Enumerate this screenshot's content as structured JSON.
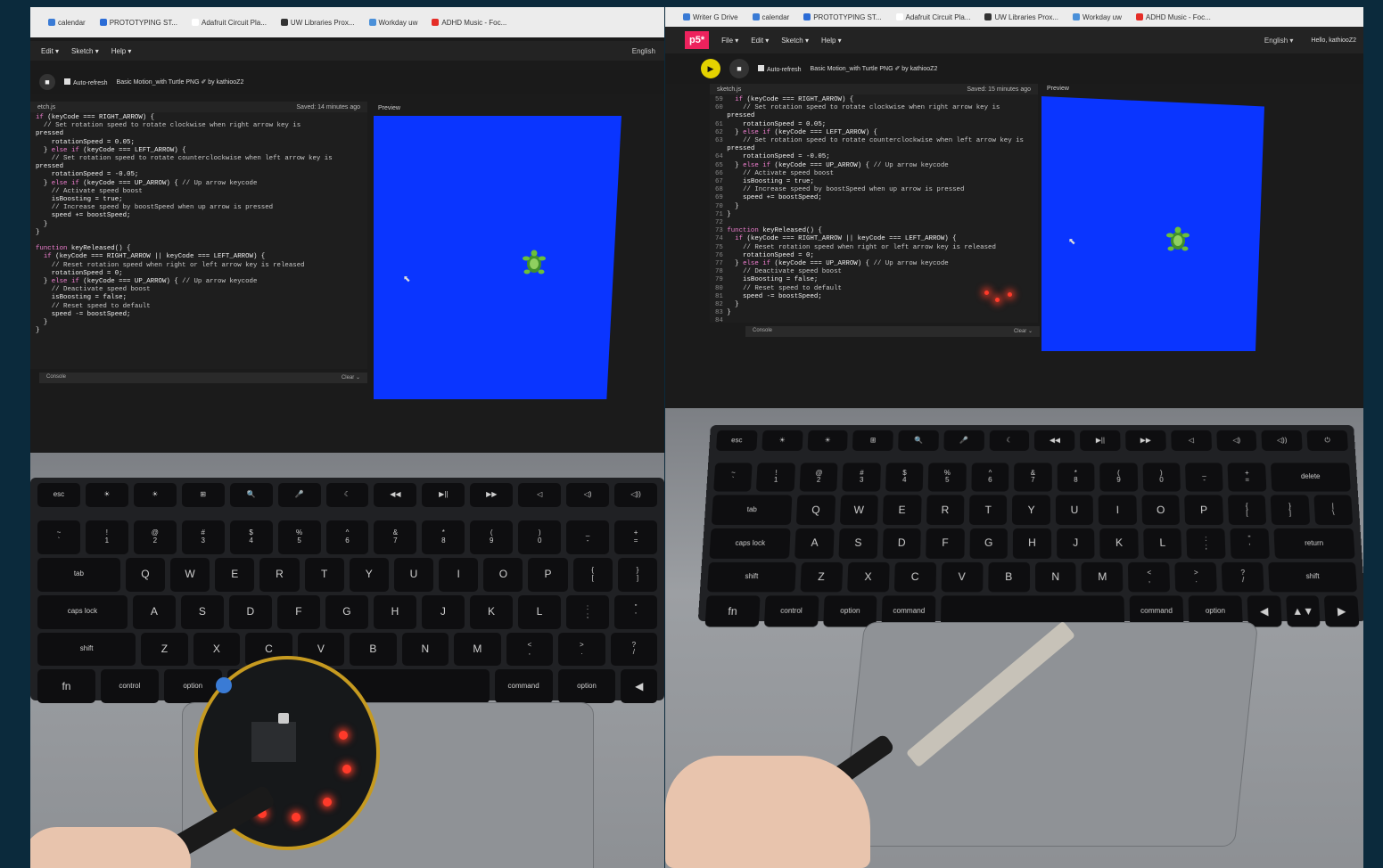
{
  "left_photo": {
    "bookmarks": [
      {
        "label": "calendar",
        "color": "#3a7bd5"
      },
      {
        "label": "PROTOTYPING ST...",
        "color": "#2b6cd6"
      },
      {
        "label": "Adafruit Circuit Pla...",
        "color": "#ffffff"
      },
      {
        "label": "UW Libraries Prox...",
        "color": "#333333"
      },
      {
        "label": "Workday uw",
        "color": "#4a90d9"
      },
      {
        "label": "ADHD Music - Foc...",
        "color": "#e52d27"
      }
    ],
    "menu": [
      "Edit ▾",
      "Sketch ▾",
      "Help ▾"
    ],
    "language": "English",
    "auto_refresh": "Auto-refresh",
    "sketch_name": "Basic Motion_with Turtle PNG ✐ by kathiooZ2",
    "file_tab": "etch.js",
    "saved": "Saved: 14 minutes ago",
    "preview": "Preview",
    "console": "Console",
    "clear": "Clear ⌄",
    "code": "if (keyCode === RIGHT_ARROW) {\n  // Set rotation speed to rotate clockwise when right arrow key is\npressed\n    rotationSpeed = 0.05;\n  } else if (keyCode === LEFT_ARROW) {\n    // Set rotation speed to rotate counterclockwise when left arrow key is\npressed\n    rotationSpeed = -0.05;\n  } else if (keyCode === UP_ARROW) { // Up arrow keycode\n    // Activate speed boost\n    isBoosting = true;\n    // Increase speed by boostSpeed when up arrow is pressed\n    speed += boostSpeed;\n  }\n}\n\nfunction keyReleased() {\n  if (keyCode === RIGHT_ARROW || keyCode === LEFT_ARROW) {\n    // Reset rotation speed when right or left arrow key is released\n    rotationSpeed = 0;\n  } else if (keyCode === UP_ARROW) { // Up arrow keycode\n    // Deactivate speed boost\n    isBoosting = false;\n    // Reset speed to default\n    speed -= boostSpeed;\n  }\n}"
  },
  "right_photo": {
    "bookmarks": [
      {
        "label": "Writer G Drive",
        "color": "#3a7bd5"
      },
      {
        "label": "calendar",
        "color": "#3a7bd5"
      },
      {
        "label": "PROTOTYPING ST...",
        "color": "#2b6cd6"
      },
      {
        "label": "Adafruit Circuit Pla...",
        "color": "#ffffff"
      },
      {
        "label": "UW Libraries Prox...",
        "color": "#333333"
      },
      {
        "label": "Workday uw",
        "color": "#4a90d9"
      },
      {
        "label": "ADHD Music - Foc...",
        "color": "#e52d27"
      }
    ],
    "logo": "p5*",
    "menu": [
      "File ▾",
      "Edit ▾",
      "Sketch ▾",
      "Help ▾"
    ],
    "language": "English ▾",
    "user": "Hello, kathiooZ2",
    "auto_refresh": "Auto-refresh",
    "sketch_name": "Basic Motion_with Turtle PNG ✐ by kathiooZ2",
    "file_tab": "sketch.js",
    "saved": "Saved: 15 minutes ago",
    "preview": "Preview",
    "console": "Console",
    "clear": "Clear ⌄",
    "code": "59   if (keyCode === RIGHT_ARROW) {\n60     // Set rotation speed to rotate clockwise when right arrow key is\n   pressed\n61     rotationSpeed = 0.05;\n62   } else if (keyCode === LEFT_ARROW) {\n63     // Set rotation speed to rotate counterclockwise when left arrow key is\n   pressed\n64     rotationSpeed = -0.05;\n65   } else if (keyCode === UP_ARROW) { // Up arrow keycode\n66     // Activate speed boost\n67     isBoosting = true;\n68     // Increase speed by boostSpeed when up arrow is pressed\n69     speed += boostSpeed;\n70   }\n71 }\n72\n73 function keyReleased() {\n74   if (keyCode === RIGHT_ARROW || keyCode === LEFT_ARROW) {\n75     // Reset rotation speed when right or left arrow key is released\n76     rotationSpeed = 0;\n77   } else if (keyCode === UP_ARROW) { // Up arrow keycode\n78     // Deactivate speed boost\n79     isBoosting = false;\n80     // Reset speed to default\n81     speed -= boostSpeed;\n82   }\n83 }\n84"
  },
  "keyboard_left": {
    "fn_row": [
      "esc",
      "☀",
      "☀",
      "⊞",
      "🔍",
      "🎤",
      "☾",
      "◀◀",
      "▶||",
      "▶▶",
      "◁",
      "◁)",
      "◁))"
    ],
    "num_row": [
      "~\n`",
      "!\n1",
      "@\n2",
      "#\n3",
      "$\n4",
      "%\n5",
      "^\n6",
      "&\n7",
      "*\n8",
      "(\n9",
      ")\n0",
      "_\n-",
      "+\n="
    ],
    "q_row": [
      "tab",
      "Q",
      "W",
      "E",
      "R",
      "T",
      "Y",
      "U",
      "I",
      "O",
      "P",
      "{\n[",
      "}\n]"
    ],
    "a_row": [
      "caps lock",
      "A",
      "S",
      "D",
      "F",
      "G",
      "H",
      "J",
      "K",
      "L",
      ":\n;",
      "\"\n'"
    ],
    "z_row": [
      "shift",
      "Z",
      "X",
      "C",
      "V",
      "B",
      "N",
      "M",
      "<\n,",
      ">\n.",
      "?\n/"
    ],
    "bottom_row": [
      "fn",
      "control",
      "option",
      "command",
      "",
      "command",
      "option",
      "◀"
    ]
  },
  "keyboard_right": {
    "fn_row": [
      "esc",
      "☀",
      "☀",
      "⊞",
      "🔍",
      "🎤",
      "☾",
      "◀◀",
      "▶||",
      "▶▶",
      "◁",
      "◁)",
      "◁))",
      "⏻"
    ],
    "num_row": [
      "~\n`",
      "!\n1",
      "@\n2",
      "#\n3",
      "$\n4",
      "%\n5",
      "^\n6",
      "&\n7",
      "*\n8",
      "(\n9",
      ")\n0",
      "_\n-",
      "+\n=",
      "delete"
    ],
    "q_row": [
      "tab",
      "Q",
      "W",
      "E",
      "R",
      "T",
      "Y",
      "U",
      "I",
      "O",
      "P",
      "{\n[",
      "}\n]",
      "|\n\\"
    ],
    "a_row": [
      "caps lock",
      "A",
      "S",
      "D",
      "F",
      "G",
      "H",
      "J",
      "K",
      "L",
      ":\n;",
      "\"\n'",
      "return"
    ],
    "z_row": [
      "shift",
      "Z",
      "X",
      "C",
      "V",
      "B",
      "N",
      "M",
      "<\n,",
      ">\n.",
      "?\n/",
      "shift"
    ],
    "bottom_row": [
      "fn",
      "control",
      "option",
      "command",
      "",
      "command",
      "option",
      "◀",
      "▲▼",
      "▶"
    ]
  }
}
